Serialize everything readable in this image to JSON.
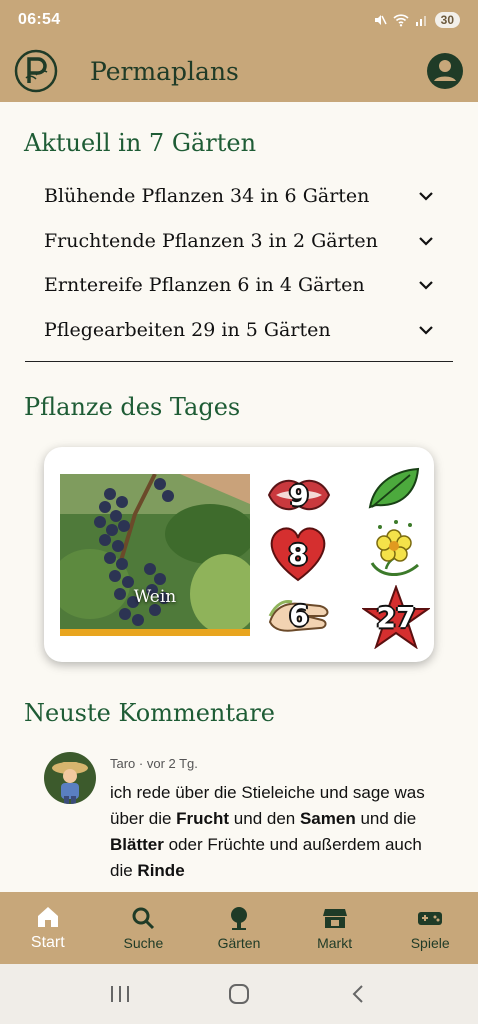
{
  "status": {
    "time": "06:54",
    "battery": "30"
  },
  "app": {
    "title": "Permaplans"
  },
  "sections": {
    "aktuell_title": "Aktuell in 7 Gärten",
    "pflanze_title": "Pflanze des Tages",
    "kommentare_title": "Neuste Kommentare"
  },
  "aktuell_items": [
    {
      "label": "Blühende Pflanzen 34 in 6 Gärten"
    },
    {
      "label": "Fruchtende Pflanzen 3 in 2 Gärten"
    },
    {
      "label": "Erntereife Pflanzen 6 in 4 Gärten"
    },
    {
      "label": "Pflegearbeiten 29 in 5 Gärten"
    }
  ],
  "plant_of_day": {
    "name": "Wein",
    "badges": {
      "taste": "9",
      "heart": "8",
      "hands": "6",
      "star": "27"
    }
  },
  "comment": {
    "meta": "Taro · vor 2 Tg.",
    "parts": [
      "ich rede über die Stieleiche und sage was über die ",
      "Frucht",
      " und den ",
      "Samen",
      " und die ",
      "Blätter",
      " oder Früchte und außerdem auch die ",
      "Rinde"
    ]
  },
  "nav": [
    {
      "label": "Start",
      "icon": "home-icon"
    },
    {
      "label": "Suche",
      "icon": "search-icon"
    },
    {
      "label": "Gärten",
      "icon": "tree-icon"
    },
    {
      "label": "Markt",
      "icon": "store-icon"
    },
    {
      "label": "Spiele",
      "icon": "gamepad-icon"
    }
  ],
  "colors": {
    "brand": "#c7a77a",
    "accent_green": "#1e5c35",
    "dark_green": "#1f3b27"
  }
}
